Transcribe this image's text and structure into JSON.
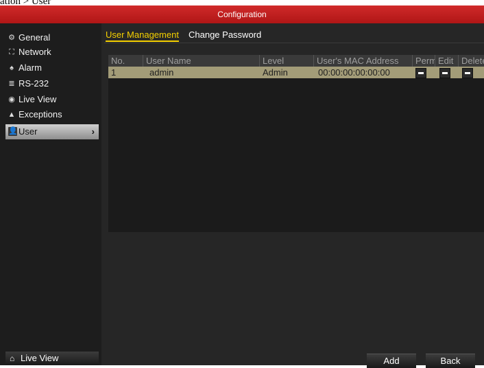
{
  "breadcrumb": "ation > User",
  "title": "Configuration",
  "sidebar": {
    "items": [
      {
        "label": "General",
        "icon": "gear-icon",
        "glyph": "⚙"
      },
      {
        "label": "Network",
        "icon": "network-icon",
        "glyph": "⛶"
      },
      {
        "label": "Alarm",
        "icon": "alarm-icon",
        "glyph": "♠"
      },
      {
        "label": "RS-232",
        "icon": "rs232-icon",
        "glyph": "≣"
      },
      {
        "label": "Live View",
        "icon": "eye-icon",
        "glyph": "◉"
      },
      {
        "label": "Exceptions",
        "icon": "warning-icon",
        "glyph": "▲"
      },
      {
        "label": "User",
        "icon": "user-icon",
        "glyph": "👤"
      }
    ],
    "live_view": {
      "label": "Live View",
      "glyph": "⌂"
    }
  },
  "tabs": [
    "User Management",
    "Change Password"
  ],
  "table": {
    "headers": [
      "No.",
      "User Name",
      "Level",
      "User's MAC Address",
      "Perm",
      "Edit",
      "Delete"
    ],
    "rows": [
      {
        "no": "1",
        "name": "admin",
        "level": "Admin",
        "mac": "00:00:00:00:00:00"
      }
    ]
  },
  "buttons": {
    "add": "Add",
    "back": "Back"
  },
  "colors": {
    "title_bar": "#c41e1e",
    "active_tab": "#f5d000",
    "selected_row": "#a39c78"
  }
}
